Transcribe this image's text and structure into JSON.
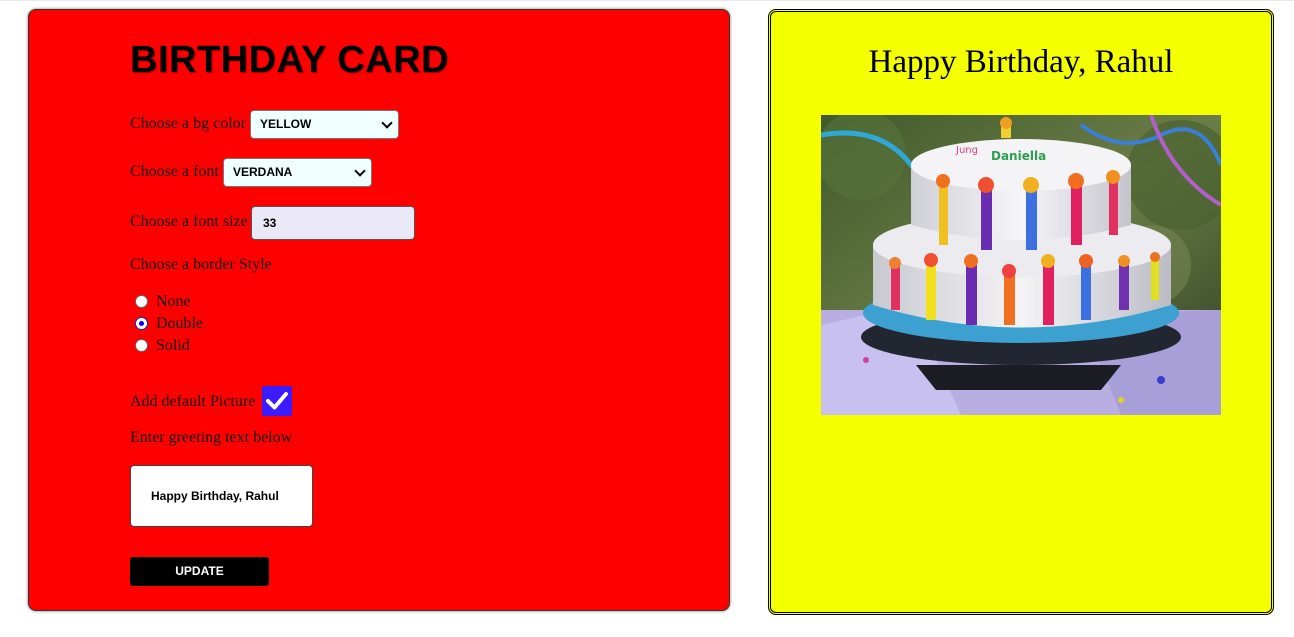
{
  "form": {
    "title": "BIRTHDAY CARD",
    "bg_color_label": "Choose a bg color",
    "bg_color_value": "YELLOW",
    "font_label": "Choose a font",
    "font_value": "VERDANA",
    "font_size_label": "Choose a font size",
    "font_size_value": "33",
    "border_style_label": "Choose a border Style",
    "border_options": [
      "None",
      "Double",
      "Solid"
    ],
    "border_selected": "Double",
    "default_picture_label": "Add default Picture",
    "default_picture_checked": true,
    "greeting_label": "Enter greeting text below",
    "greeting_value": "Happy Birthday, Rahul",
    "update_label": "UPDATE"
  },
  "card": {
    "greeting": "Happy Birthday, Rahul",
    "bg_color": "#f4ff00",
    "border_style": "double"
  },
  "colors": {
    "form_bg": "#ff0000",
    "card_bg": "#f4ff00",
    "checkbox": "#3b1bff",
    "button_bg": "#000000"
  },
  "icons": {
    "checkbox": "checkmark-icon",
    "select_arrow": "chevron-down-icon"
  }
}
